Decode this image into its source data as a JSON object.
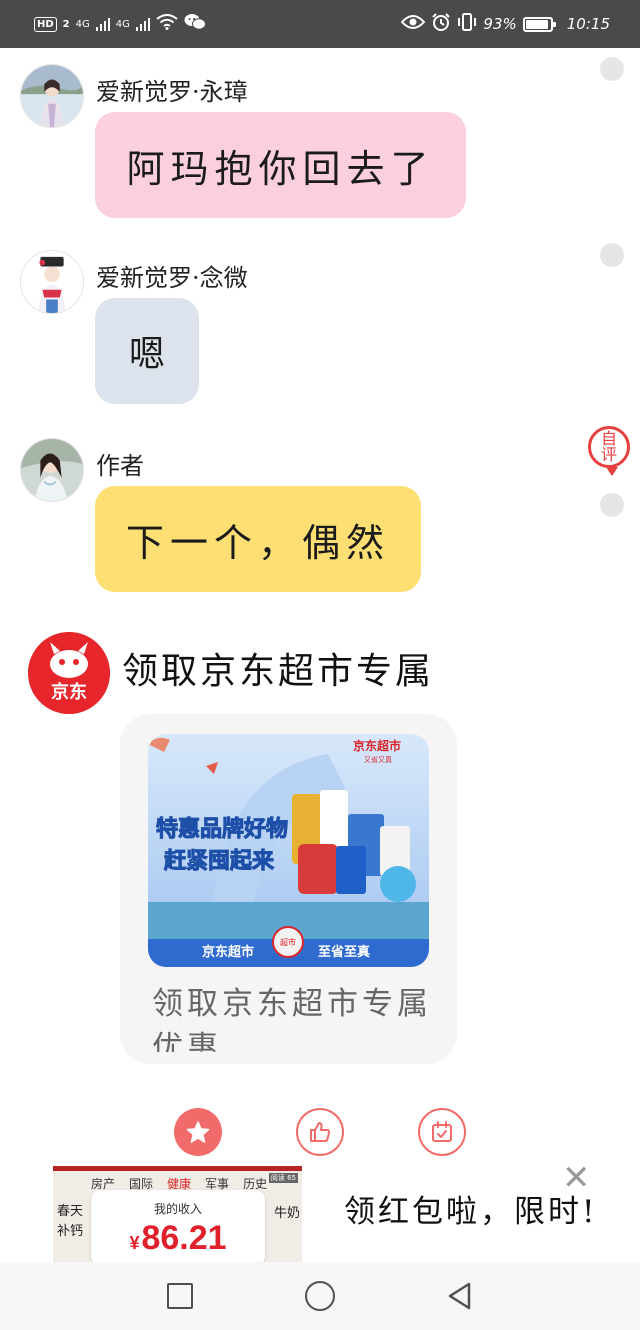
{
  "status_bar": {
    "hd_label": "HD",
    "sim1": "2",
    "network1": "4G",
    "network2": "4G",
    "battery_percent": "93%",
    "battery_level": 0.93,
    "time": "10:15"
  },
  "messages": [
    {
      "sender": "爱新觉罗·永璋",
      "text": "阿玛抱你回去了",
      "bubble_color": "#fbd0dc"
    },
    {
      "sender": "爱新觉罗·念微",
      "text": "嗯",
      "bubble_color": "#dde3ec"
    },
    {
      "sender": "作者",
      "text": "下一个，偶然",
      "bubble_color": "#fddf74"
    }
  ],
  "danmu_badge": {
    "line1": "自",
    "line2": "评"
  },
  "jd_ad": {
    "logo_text": "京东",
    "title": "领取京东超市专属",
    "card_text": "领取京东超市专属优惠",
    "banner": {
      "brand": "京东超市",
      "brand_sub": "又省又真",
      "headline1": "特惠品牌好物",
      "headline2": "赶紧囤起来",
      "bottom_left": "京东超市",
      "bottom_right": "至省至真",
      "badge": "超市"
    }
  },
  "actions": [
    {
      "name": "favorite",
      "icon": "star-icon"
    },
    {
      "name": "like",
      "icon": "thumbs-up-icon"
    },
    {
      "name": "save",
      "icon": "calendar-check-icon"
    }
  ],
  "bottom_ad": {
    "tabs": [
      "房产",
      "国际",
      "健康",
      "军事",
      "历史"
    ],
    "side_left1": "春天",
    "side_left2": "补钙",
    "side_right": "牛奶",
    "tag": "阅读 65",
    "income_label": "我的收入",
    "income_currency": "¥",
    "income_value": "86.21",
    "close_symbol": "✕",
    "text": "领红包啦，限时!"
  },
  "colors": {
    "accent_red": "#f26b6b",
    "jd_red": "#e6262a",
    "status_bar_bg": "#4a4a4a"
  }
}
